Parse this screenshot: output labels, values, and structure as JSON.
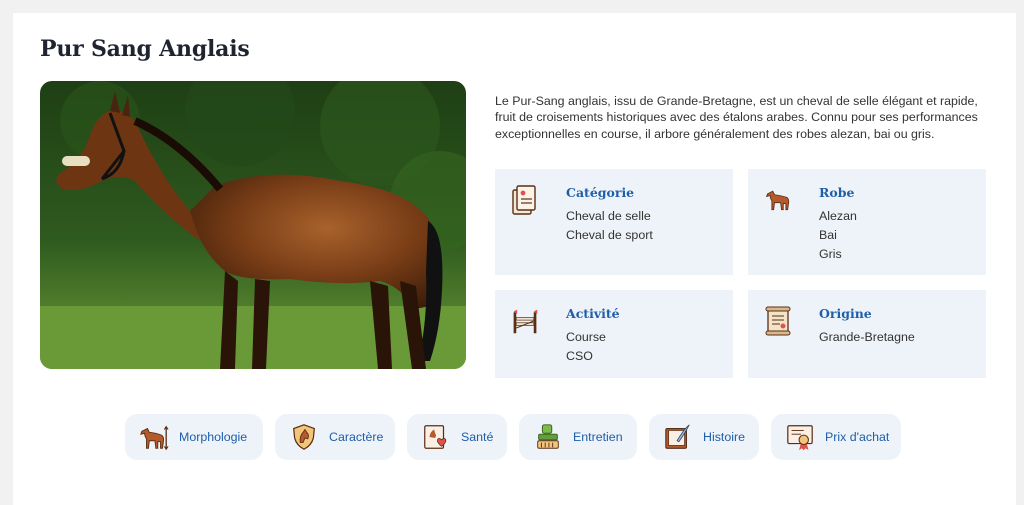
{
  "page": {
    "title": "Pur Sang Anglais"
  },
  "description": "Le Pur-Sang anglais, issu de Grande-Bretagne, est un cheval de selle élégant et rapide, fruit de croisements historiques avec des étalons arabes. Connu pour ses performances exceptionnelles en course, il arbore généralement des robes alezan, bai ou gris.",
  "info_cards": [
    {
      "label": "Catégorie",
      "values": [
        "Cheval de selle",
        "Cheval de sport"
      ],
      "icon": "document-stack-icon"
    },
    {
      "label": "Robe",
      "values": [
        "Alezan",
        "Bai",
        "Gris"
      ],
      "icon": "horse-icon"
    },
    {
      "label": "Activité",
      "values": [
        "Course",
        "CSO"
      ],
      "icon": "show-jumping-fence-icon"
    },
    {
      "label": "Origine",
      "values": [
        "Grande-Bretagne"
      ],
      "icon": "scroll-icon"
    }
  ],
  "nav": [
    {
      "label": "Morphologie",
      "icon": "horse-measure-icon"
    },
    {
      "label": "Caractère",
      "icon": "horse-shield-icon"
    },
    {
      "label": "Santé",
      "icon": "health-record-icon"
    },
    {
      "label": "Entretien",
      "icon": "grooming-icon"
    },
    {
      "label": "Histoire",
      "icon": "book-quill-icon"
    },
    {
      "label": "Prix d'achat",
      "icon": "certificate-icon"
    }
  ],
  "colors": {
    "accent": "#1f5ea8",
    "card_bg": "#edf3f8",
    "page_bg": "#f1f1f1"
  }
}
